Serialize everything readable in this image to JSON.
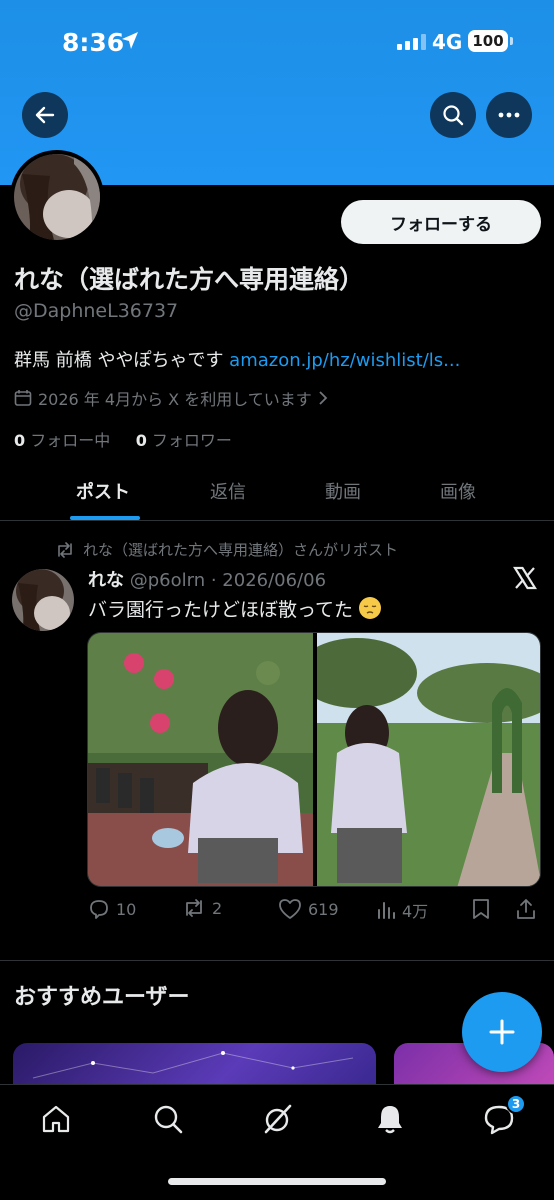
{
  "status_bar": {
    "time": "8:36",
    "network": "4G",
    "battery": "100"
  },
  "profile": {
    "follow_label": "フォローする",
    "display_name": "れな（選ばれた方へ専用連絡）",
    "handle": "@DaphneL36737",
    "bio_text": "群馬 前橋 ややぽちゃです ",
    "bio_link": "amazon.jp/hz/wishlist/ls...",
    "joined": "2026 年 4月から X を利用しています",
    "following_count": "0",
    "following_label": "フォロー中",
    "followers_count": "0",
    "followers_label": "フォロワー"
  },
  "tabs": [
    {
      "label": "ポスト",
      "active": true
    },
    {
      "label": "返信",
      "active": false
    },
    {
      "label": "動画",
      "active": false
    },
    {
      "label": "画像",
      "active": false
    }
  ],
  "post": {
    "repost_by": "れな（選ばれた方へ専用連絡）さんがリポスト",
    "author": "れな",
    "meta": "@p6olrn · 2026/06/06",
    "text": "バラ園行ったけどほぼ散ってた",
    "emoji": "pensive-face-emoji",
    "replies": "10",
    "reposts": "2",
    "likes": "619",
    "views": "4万"
  },
  "recommended": {
    "title": "おすすめユーザー"
  },
  "nav": {
    "messages_badge": "3"
  },
  "colors": {
    "accent": "#1d9bf0",
    "banner": "#1d8fe6",
    "background": "#000000",
    "muted": "#71767b"
  },
  "icons": [
    "back-arrow-icon",
    "search-icon",
    "more-icon",
    "calendar-icon",
    "chevron-right-icon",
    "repost-icon",
    "x-logo-icon",
    "reply-icon",
    "like-icon",
    "views-icon",
    "bookmark-icon",
    "share-icon",
    "plus-icon",
    "home-icon",
    "grok-icon",
    "bell-icon",
    "messages-icon"
  ]
}
